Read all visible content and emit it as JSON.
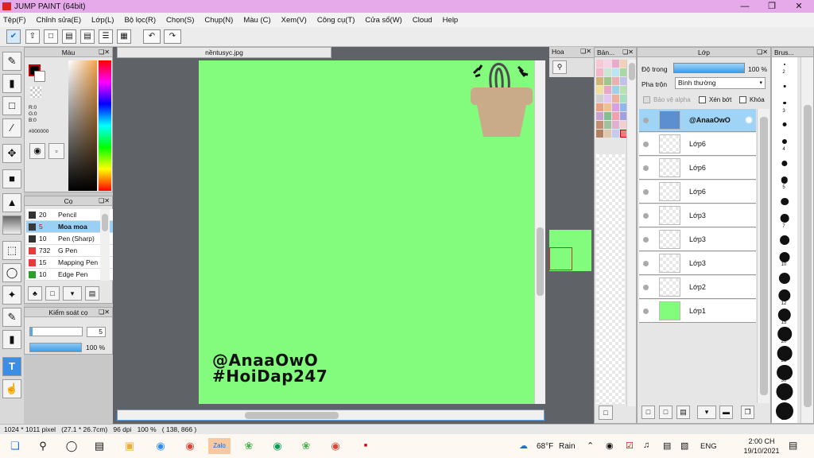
{
  "app": {
    "title": "JUMP PAINT (64bit)"
  },
  "menu": [
    "Tệp(F)",
    "Chỉnh sửa(E)",
    "Lớp(L)",
    "Bộ lọc(R)",
    "Chọn(S)",
    "Chụp(N)",
    "Màu (C)",
    "Xem(V)",
    "Công cụ(T)",
    "Cửa sổ(W)",
    "Cloud",
    "Help"
  ],
  "color_panel": {
    "title": "Màu",
    "r": "R:0",
    "g": "G:0",
    "b": "B:0",
    "hex": "#000000"
  },
  "brush_panel": {
    "title": "Cọ",
    "items": [
      {
        "size": "20",
        "name": "Pencil",
        "color": "#333333"
      },
      {
        "size": "5",
        "name": "Moa moa",
        "color": "#3a3a3a"
      },
      {
        "size": "10",
        "name": "Pen (Sharp)",
        "color": "#333333"
      },
      {
        "size": "732",
        "name": "G Pen",
        "color": "#e83a3a"
      },
      {
        "size": "15",
        "name": "Mapping Pen",
        "color": "#e83a3a"
      },
      {
        "size": "10",
        "name": "Edge Pen",
        "color": "#2aa02a"
      }
    ]
  },
  "brush_control": {
    "title": "Kiểm soát cọ",
    "size_value": "5",
    "opacity_text": "100 %",
    "opacity_fraction": 1.0
  },
  "canvas": {
    "tab_title": "nềntusyc.jpg",
    "text_line1": "@AnaaOwO",
    "text_line2": "#HoiDap247",
    "bg_color": "#83fb7d"
  },
  "navigator": {
    "title": "Hoa"
  },
  "palette": {
    "title": "Bản..."
  },
  "layer_panel": {
    "title": "Lớp",
    "opacity_label": "Độ trong",
    "opacity_value": "100 %",
    "blend_label": "Pha trộn",
    "blend_value": "Bình thường",
    "check_alpha": "Bảo vệ alpha",
    "check_clip": "Xén bớt",
    "check_lock": "Khóa",
    "layers": [
      "@AnaaOwO",
      "Lớp6",
      "Lớp6",
      "Lớp6",
      "Lớp3",
      "Lớp3",
      "Lớp3",
      "Lớp2",
      "Lớp1"
    ]
  },
  "brush_sizes": {
    "title": "Brus...",
    "labels": [
      "2",
      "",
      "3",
      "",
      "4",
      "",
      "5",
      "",
      "7",
      "",
      "10",
      "",
      "12",
      "15",
      "20",
      "25",
      "30",
      "40",
      "50"
    ]
  },
  "status": {
    "text": "1024 * 1011 pixel   (27.1 * 26.7cm)   96 dpi   100 %   ( 138, 866 )"
  },
  "taskbar": {
    "weather_temp": "68°F",
    "weather_text": "Rain",
    "lang": "ENG",
    "time": "2:00 CH",
    "date": "19/10/2021"
  }
}
